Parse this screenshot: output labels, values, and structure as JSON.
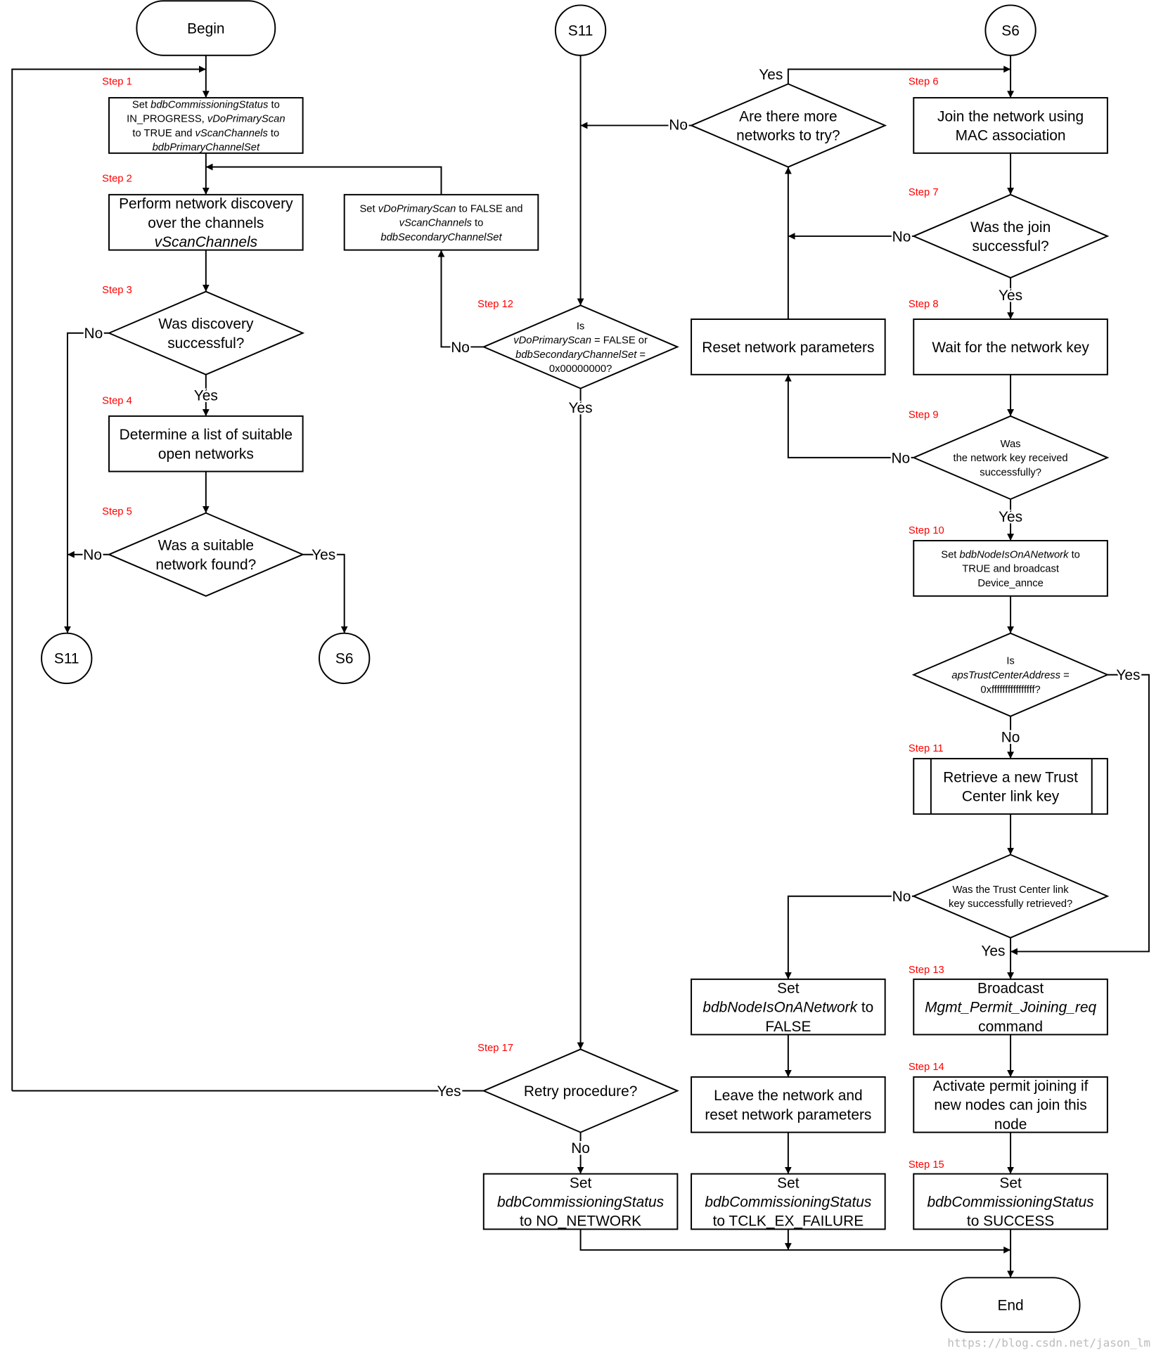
{
  "colors": {
    "step_label": "#ff0000",
    "stroke": "#000000",
    "watermark": "#bbbbbb"
  },
  "terminals": {
    "begin": "Begin",
    "end": "End",
    "s11_top": "S11",
    "s6_top": "S6",
    "s11_bottom": "S11",
    "s6_bottom": "S6"
  },
  "steps": {
    "s1": "Step 1",
    "s2": "Step 2",
    "s3": "Step 3",
    "s4": "Step 4",
    "s5": "Step 5",
    "s6": "Step 6",
    "s7": "Step 7",
    "s8": "Step 8",
    "s9": "Step 9",
    "s10": "Step 10",
    "s11": "Step 11",
    "s12": "Step 12",
    "s13": "Step 13",
    "s14": "Step 14",
    "s15": "Step 15",
    "s17": "Step 17"
  },
  "nodes": {
    "step1": [
      [
        {
          "t": "Set "
        },
        {
          "t": "bdbCommissioningStatus",
          "i": true
        },
        {
          "t": " to"
        }
      ],
      [
        {
          "t": "IN_PROGRESS, "
        },
        {
          "t": "vDoPrimaryScan",
          "i": true
        }
      ],
      [
        {
          "t": "to TRUE and "
        },
        {
          "t": "vScanChannels",
          "i": true
        },
        {
          "t": " to"
        }
      ],
      [
        {
          "t": "bdbPrimaryChannelSet",
          "i": true
        }
      ]
    ],
    "step2": [
      [
        {
          "t": "Perform network discovery"
        }
      ],
      [
        {
          "t": "over the channels"
        }
      ],
      [
        {
          "t": "vScanChannels",
          "i": true
        }
      ]
    ],
    "secondary": [
      [
        {
          "t": "Set "
        },
        {
          "t": "vDoPrimaryScan",
          "i": true
        },
        {
          "t": " to FALSE and"
        }
      ],
      [
        {
          "t": "vScanChannels",
          "i": true
        },
        {
          "t": " to"
        }
      ],
      [
        {
          "t": "bdbSecondaryChannelSet",
          "i": true
        }
      ]
    ],
    "step3": [
      [
        {
          "t": "Was discovery"
        }
      ],
      [
        {
          "t": "successful?"
        }
      ]
    ],
    "step4": [
      [
        {
          "t": "Determine a list of suitable"
        }
      ],
      [
        {
          "t": "open networks"
        }
      ]
    ],
    "step5": [
      [
        {
          "t": "Was a suitable"
        }
      ],
      [
        {
          "t": "network found?"
        }
      ]
    ],
    "step12": [
      [
        {
          "t": "Is"
        }
      ],
      [
        {
          "t": "vDoPrimaryScan",
          "i": true
        },
        {
          "t": " = FALSE or"
        }
      ],
      [
        {
          "t": "bdbSecondaryChannelSet",
          "i": true
        },
        {
          "t": " ="
        }
      ],
      [
        {
          "t": "0x00000000?"
        }
      ]
    ],
    "more": [
      [
        {
          "t": "Are there more"
        }
      ],
      [
        {
          "t": "networks to try?"
        }
      ]
    ],
    "reset": [
      [
        {
          "t": "Reset network parameters"
        }
      ]
    ],
    "step6": [
      [
        {
          "t": "Join the network using"
        }
      ],
      [
        {
          "t": "MAC association"
        }
      ]
    ],
    "step7": [
      [
        {
          "t": "Was the join"
        }
      ],
      [
        {
          "t": "successful?"
        }
      ]
    ],
    "step8": [
      [
        {
          "t": "Wait for the network key"
        }
      ]
    ],
    "step9": [
      [
        {
          "t": "Was"
        }
      ],
      [
        {
          "t": "the network key received"
        }
      ],
      [
        {
          "t": "successfully?"
        }
      ]
    ],
    "step10": [
      [
        {
          "t": "Set "
        },
        {
          "t": "bdbNodeIsOnANetwork",
          "i": true
        },
        {
          "t": " to"
        }
      ],
      [
        {
          "t": "TRUE and broadcast"
        }
      ],
      [
        {
          "t": "Device_annce"
        }
      ]
    ],
    "tcaddr": [
      [
        {
          "t": "Is"
        }
      ],
      [
        {
          "t": "apsTrustCenterAddress",
          "i": true
        },
        {
          "t": " ="
        }
      ],
      [
        {
          "t": "0xffffffffffffffff?"
        }
      ]
    ],
    "step11": [
      [
        {
          "t": "Retrieve a new Trust"
        }
      ],
      [
        {
          "t": "Center link key"
        }
      ]
    ],
    "tcok": [
      [
        {
          "t": "Was the Trust Center link"
        }
      ],
      [
        {
          "t": "key successfully retrieved?"
        }
      ]
    ],
    "nodefalse": [
      [
        {
          "t": "Set"
        }
      ],
      [
        {
          "t": "bdbNodeIsOnANetwork",
          "i": true
        },
        {
          "t": " to"
        }
      ],
      [
        {
          "t": "FALSE"
        }
      ]
    ],
    "step13": [
      [
        {
          "t": "Broadcast"
        }
      ],
      [
        {
          "t": "Mgmt_Permit_Joining_req",
          "i": true
        }
      ],
      [
        {
          "t": "command"
        }
      ]
    ],
    "leave": [
      [
        {
          "t": "Leave the network and"
        }
      ],
      [
        {
          "t": "reset network parameters"
        }
      ]
    ],
    "step14": [
      [
        {
          "t": "Activate permit joining if"
        }
      ],
      [
        {
          "t": "new nodes can join this"
        }
      ],
      [
        {
          "t": "node"
        }
      ]
    ],
    "step17": [
      [
        {
          "t": "Retry procedure?"
        }
      ]
    ],
    "nonet": [
      [
        {
          "t": "Set"
        }
      ],
      [
        {
          "t": "bdbCommissioningStatus",
          "i": true
        }
      ],
      [
        {
          "t": "to NO_NETWORK"
        }
      ]
    ],
    "tclk": [
      [
        {
          "t": "Set"
        }
      ],
      [
        {
          "t": "bdbCommissioningStatus",
          "i": true
        }
      ],
      [
        {
          "t": "to TCLK_EX_FAILURE"
        }
      ]
    ],
    "step15": [
      [
        {
          "t": "Set"
        }
      ],
      [
        {
          "t": "bdbCommissioningStatus",
          "i": true
        }
      ],
      [
        {
          "t": "to SUCCESS"
        }
      ]
    ]
  },
  "edge_labels": {
    "yes": "Yes",
    "no": "No"
  },
  "watermark": "https://blog.csdn.net/jason_lm"
}
